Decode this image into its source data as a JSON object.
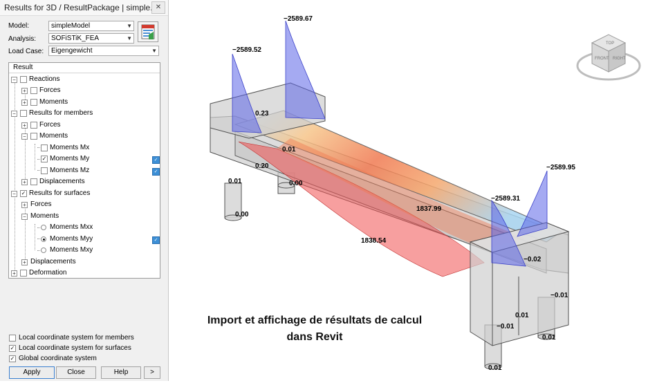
{
  "window": {
    "title": "Results for 3D / ResultPackage | simple...",
    "close_glyph": "✕"
  },
  "form": {
    "model_label": "Model:",
    "model_value": "simpleModel",
    "analysis_label": "Analysis:",
    "analysis_value": "SOFiSTiK_FEA",
    "loadcase_label": "Load Case:",
    "loadcase_value": "Eigengewicht"
  },
  "tree": {
    "header": "Result",
    "items": [
      {
        "label": "Reactions"
      },
      {
        "label": "Forces"
      },
      {
        "label": "Moments"
      },
      {
        "label": "Results for members"
      },
      {
        "label": "Forces"
      },
      {
        "label": "Moments"
      },
      {
        "label": "Moments Mx"
      },
      {
        "label": "Moments My"
      },
      {
        "label": "Moments Mz"
      },
      {
        "label": "Displacements"
      },
      {
        "label": "Results for surfaces"
      },
      {
        "label": "Forces"
      },
      {
        "label": "Moments"
      },
      {
        "label": "Moments Mxx"
      },
      {
        "label": "Moments Myy"
      },
      {
        "label": "Moments Mxy"
      },
      {
        "label": "Displacements"
      },
      {
        "label": "Deformation"
      }
    ]
  },
  "options": [
    {
      "label": "Local coordinate system for members",
      "checked": false
    },
    {
      "label": "Local coordinate system for surfaces",
      "checked": true
    },
    {
      "label": "Global coordinate system",
      "checked": true
    }
  ],
  "buttons": {
    "apply": "Apply",
    "close": "Close",
    "help": "Help",
    "next": ">"
  },
  "viewcube": {
    "top": "TOP",
    "front": "FRONT",
    "right": "RIGHT"
  },
  "scene_labels": {
    "v1": "−2589.67",
    "v2": "−2589.52",
    "v3": "−2589.95",
    "v4": "−2589.31",
    "v5": "0.23",
    "v6": "0.01",
    "v7": "0.20",
    "v8": "0.01",
    "v9": "0.00",
    "v10": "0.00",
    "v11": "1837.99",
    "v12": "1838.54",
    "v13": "−0.02",
    "v14": "−0.01",
    "v15": "−0.01",
    "v16": "0.01",
    "v17": "0.01",
    "v18": "0.01"
  },
  "caption": {
    "line1": "Import et affichage de résultats de calcul",
    "line2": "dans Revit"
  },
  "colors": {
    "accent": "#3c8fd6",
    "moment_blue": "#5b64e8",
    "moment_red": "#f05050"
  }
}
